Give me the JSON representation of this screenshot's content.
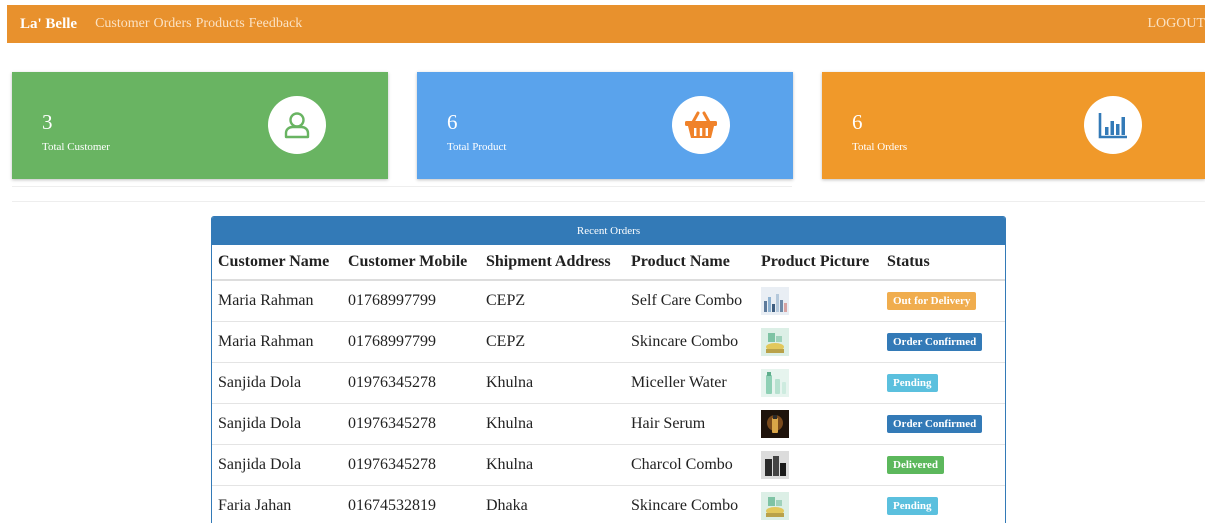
{
  "nav": {
    "brand": "La' Belle",
    "links": [
      "Customer",
      "Orders",
      "Products",
      "Feedback"
    ],
    "logout": "LOGOUT"
  },
  "cards": [
    {
      "value": "3",
      "label": "Total Customer",
      "color": "#69b462",
      "icon": "user-icon"
    },
    {
      "value": "6",
      "label": "Total Product",
      "color": "#5aa3ec",
      "icon": "basket-icon"
    },
    {
      "value": "6",
      "label": "Total Orders",
      "color": "#f0992a",
      "icon": "bar-chart-icon"
    }
  ],
  "recent_orders": {
    "title": "Recent Orders",
    "columns": [
      "Customer Name",
      "Customer Mobile",
      "Shipment Address",
      "Product Name",
      "Product Picture",
      "Status"
    ],
    "rows": [
      {
        "name": "Maria Rahman",
        "mobile": "01768997799",
        "address": "CEPZ",
        "product": "Self Care Combo",
        "picture": "self-care-combo-image",
        "status": "Out for Delivery",
        "status_color": "#f0ad4e"
      },
      {
        "name": "Maria Rahman",
        "mobile": "01768997799",
        "address": "CEPZ",
        "product": "Skincare Combo",
        "picture": "skincare-combo-image",
        "status": "Order Confirmed",
        "status_color": "#337ab7"
      },
      {
        "name": "Sanjida Dola",
        "mobile": "01976345278",
        "address": "Khulna",
        "product": "Miceller Water",
        "picture": "miceller-water-image",
        "status": "Pending",
        "status_color": "#5bc0de"
      },
      {
        "name": "Sanjida Dola",
        "mobile": "01976345278",
        "address": "Khulna",
        "product": "Hair Serum",
        "picture": "hair-serum-image",
        "status": "Order Confirmed",
        "status_color": "#337ab7"
      },
      {
        "name": "Sanjida Dola",
        "mobile": "01976345278",
        "address": "Khulna",
        "product": "Charcol Combo",
        "picture": "charcol-combo-image",
        "status": "Delivered",
        "status_color": "#5cb85c"
      },
      {
        "name": "Faria Jahan",
        "mobile": "01674532819",
        "address": "Dhaka",
        "product": "Skincare Combo",
        "picture": "skincare-combo-image",
        "status": "Pending",
        "status_color": "#5bc0de"
      }
    ]
  }
}
